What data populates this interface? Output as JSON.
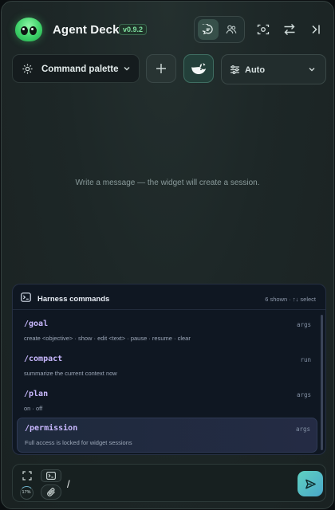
{
  "header": {
    "title": "Agent Deck",
    "version": "v0.9.2",
    "icons": [
      "chat-icon",
      "users-icon",
      "screenshot-icon",
      "swap-icon",
      "collapse-panel-icon"
    ]
  },
  "toolbar": {
    "command_palette_label": "Command palette",
    "model_label": "Auto"
  },
  "main": {
    "empty_message": "Write a message — the widget will create a session."
  },
  "harness": {
    "title": "Harness commands",
    "meta": "6 shown · ↑↓ select",
    "commands": [
      {
        "name": "/goal",
        "kind": "args",
        "desc": "create <objective> · show · edit <text> · pause · resume · clear"
      },
      {
        "name": "/compact",
        "kind": "run",
        "desc": "summarize the current context now"
      },
      {
        "name": "/plan",
        "kind": "args",
        "desc": "on · off"
      },
      {
        "name": "/permission",
        "kind": "args",
        "desc": "Full access is locked for widget sessions"
      }
    ]
  },
  "composer": {
    "context_percent": "17%",
    "input_value": "/"
  },
  "colors": {
    "accent": "#5fd1c1",
    "command_text": "#c9b8ff",
    "version_badge": "#7fe0a0"
  }
}
